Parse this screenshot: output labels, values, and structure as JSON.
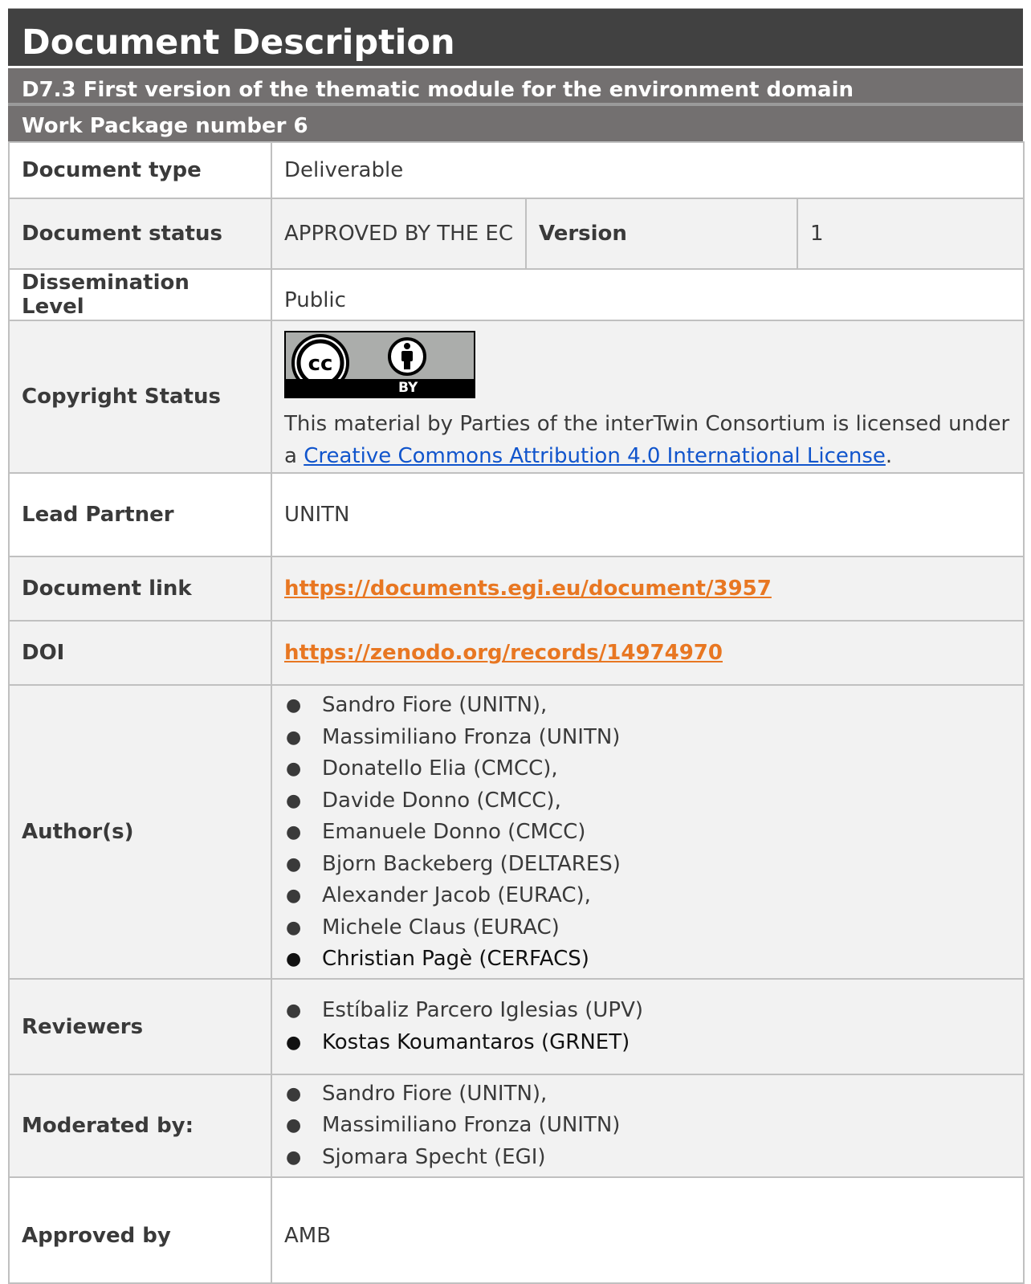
{
  "header": {
    "title": "Document Description",
    "deliverable": "D7.3 First version of the thematic module for the environment domain",
    "work_package": "Work Package number 6"
  },
  "rows": {
    "doc_type": {
      "label": "Document type",
      "value": "Deliverable"
    },
    "doc_status": {
      "label": "Document status",
      "value": "APPROVED BY THE EC",
      "version_label": "Version",
      "version_value": "1"
    },
    "dissemination": {
      "label": "Dissemination Level",
      "value": "Public"
    },
    "copyright": {
      "label": "Copyright Status",
      "badge_text": "BY",
      "text_before": "This material by Parties of the interTwin Consortium is licensed under a ",
      "link_text": "Creative Commons Attribution 4.0 International License",
      "text_after": "."
    },
    "lead_partner": {
      "label": "Lead Partner",
      "value": "UNITN"
    },
    "doc_link": {
      "label": "Document link",
      "value": "https://documents.egi.eu/document/3957"
    },
    "doi": {
      "label": "DOI",
      "value": "https://zenodo.org/records/14974970"
    },
    "authors": {
      "label": "Author(s)",
      "bullet": "●",
      "items": [
        "Sandro Fiore (UNITN),",
        "Massimiliano Fronza (UNITN)",
        "Donatello Elia (CMCC),",
        "Davide Donno (CMCC),",
        "Emanuele Donno (CMCC)",
        "Bjorn Backeberg (DELTARES)",
        "Alexander Jacob (EURAC),",
        "Michele Claus (EURAC)",
        "Christian Pagè (CERFACS)"
      ]
    },
    "reviewers": {
      "label": "Reviewers",
      "items": [
        "Estíbaliz Parcero Iglesias (UPV)",
        "Kostas Koumantaros (GRNET)"
      ]
    },
    "moderated": {
      "label": "Moderated by:",
      "items": [
        "Sandro Fiore (UNITN),",
        "Massimiliano Fronza (UNITN)",
        "Sjomara Specht (EGI)"
      ]
    },
    "approved": {
      "label": "Approved by",
      "value": "AMB"
    }
  },
  "colors": {
    "header_dark": "#414141",
    "header_grey": "#737070",
    "accent_orange": "#e87722",
    "link_blue": "#1155cc"
  }
}
